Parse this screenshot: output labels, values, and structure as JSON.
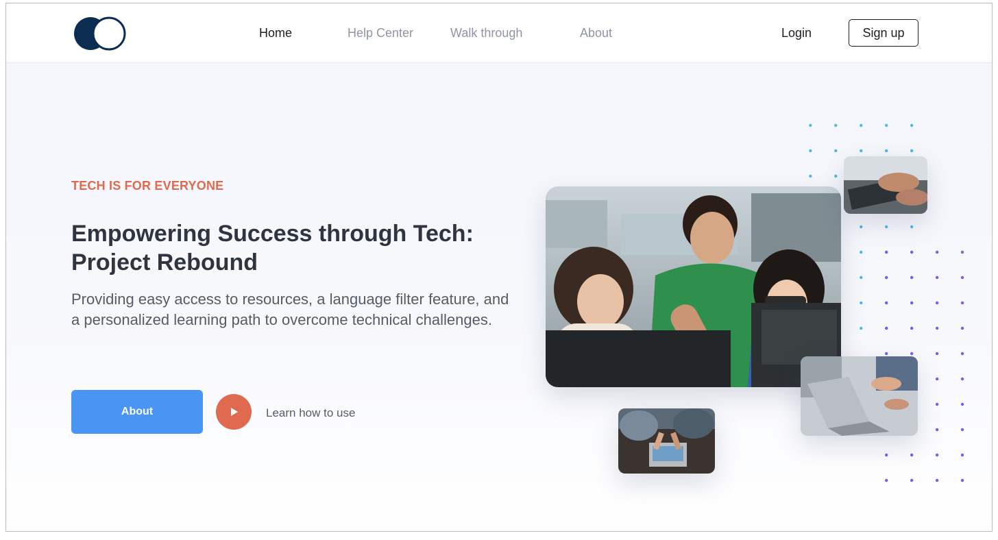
{
  "nav": {
    "links": [
      "Home",
      "Help Center",
      "Walk through",
      "About"
    ],
    "active": "Home",
    "login": "Login",
    "signup": "Sign up"
  },
  "hero": {
    "eyebrow": "TECH IS FOR EVERYONE",
    "headline_line1": "Empowering Success through Tech:",
    "headline_line2": "Project Rebound",
    "subtext": "Providing easy access to resources, a language filter feature, and a personalized learning path to overcome technical challenges.",
    "primary_button": "About",
    "secondary_link": "Learn how to use"
  },
  "icons": {
    "logo": "overlapping-circles-logo",
    "play": "play-icon"
  },
  "colors": {
    "accent_orange": "#df6a4f",
    "button_blue": "#4a95f3",
    "logo_navy": "#0c2d52",
    "dot_cyan": "#4cb8e8",
    "dot_purple": "#7b5bea"
  }
}
